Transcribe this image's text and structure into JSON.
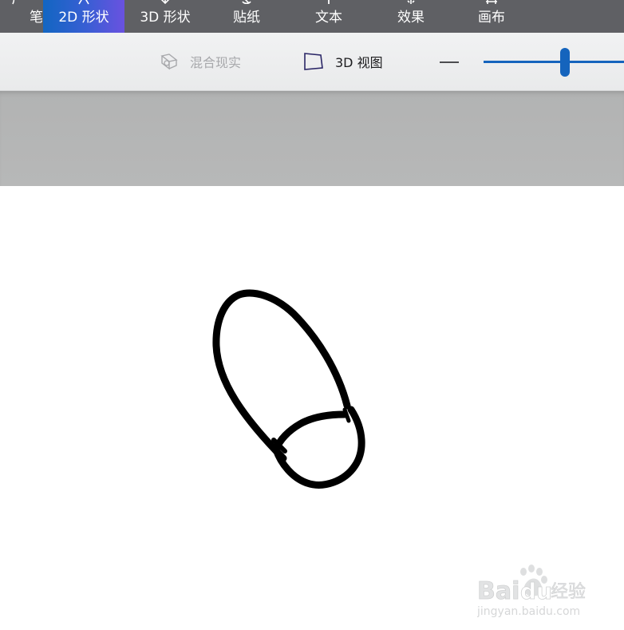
{
  "ribbon": {
    "tabs": [
      {
        "label": "画笔",
        "visible": "笔",
        "active": false
      },
      {
        "label": "2D 形状",
        "active": true
      },
      {
        "label": "3D 形状",
        "active": false
      },
      {
        "label": "贴纸",
        "active": false
      },
      {
        "label": "文本",
        "active": false
      },
      {
        "label": "效果",
        "active": false
      },
      {
        "label": "画布",
        "active": false
      }
    ]
  },
  "command_bar": {
    "mixed_reality_label": "混合现实",
    "view_3d_label": "3D 视图",
    "zoom": {
      "value_fraction": 0.58
    }
  },
  "watermark": {
    "brand": "Bai",
    "brand2": "du",
    "product": "经验",
    "domain": "jingyan.baidu.com"
  },
  "colors": {
    "ribbon_bg": "#5f6064",
    "active_tab_start": "#1266c2",
    "active_tab_end": "#6a52e0",
    "accent": "#1564bd",
    "workspace_bg": "#b3b4b4",
    "ink": "#000000"
  }
}
